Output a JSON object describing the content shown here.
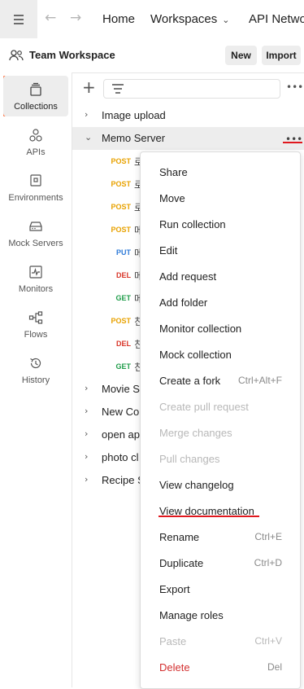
{
  "topbar": {
    "home": "Home",
    "workspaces": "Workspaces",
    "api_network": "API Network"
  },
  "workspace": {
    "title": "Team Workspace",
    "new_label": "New",
    "import_label": "Import"
  },
  "leftnav": {
    "items": [
      {
        "label": "Collections",
        "icon": "collections-icon"
      },
      {
        "label": "APIs",
        "icon": "apis-icon"
      },
      {
        "label": "Environments",
        "icon": "environments-icon"
      },
      {
        "label": "Mock Servers",
        "icon": "mock-servers-icon"
      },
      {
        "label": "Monitors",
        "icon": "monitors-icon"
      },
      {
        "label": "Flows",
        "icon": "flows-icon"
      },
      {
        "label": "History",
        "icon": "history-icon"
      }
    ]
  },
  "collections": {
    "top": [
      {
        "name": "Image upload"
      },
      {
        "name": "Memo Server"
      }
    ],
    "requests": [
      {
        "method": "POST",
        "name": "로"
      },
      {
        "method": "POST",
        "name": "로"
      },
      {
        "method": "POST",
        "name": "로"
      },
      {
        "method": "POST",
        "name": "메"
      },
      {
        "method": "PUT",
        "name": "메"
      },
      {
        "method": "DEL",
        "name": "메"
      },
      {
        "method": "GET",
        "name": "메"
      },
      {
        "method": "POST",
        "name": "친"
      },
      {
        "method": "DEL",
        "name": "친"
      },
      {
        "method": "GET",
        "name": "친"
      }
    ],
    "bottom": [
      {
        "name": "Movie S"
      },
      {
        "name": "New Co"
      },
      {
        "name": "open ap"
      },
      {
        "name": "photo cl"
      },
      {
        "name": "Recipe S"
      }
    ],
    "method_colors": {
      "POST": "#e8a200",
      "PUT": "#2f7bd8",
      "DEL": "#d9362a",
      "GET": "#1f9d4a"
    }
  },
  "context_menu": {
    "items": [
      {
        "label": "Share",
        "shortcut": "",
        "state": "normal"
      },
      {
        "label": "Move",
        "shortcut": "",
        "state": "normal"
      },
      {
        "label": "Run collection",
        "shortcut": "",
        "state": "normal"
      },
      {
        "label": "Edit",
        "shortcut": "",
        "state": "normal"
      },
      {
        "label": "Add request",
        "shortcut": "",
        "state": "normal"
      },
      {
        "label": "Add folder",
        "shortcut": "",
        "state": "normal"
      },
      {
        "label": "Monitor collection",
        "shortcut": "",
        "state": "normal"
      },
      {
        "label": "Mock collection",
        "shortcut": "",
        "state": "normal"
      },
      {
        "label": "Create a fork",
        "shortcut": "Ctrl+Alt+F",
        "state": "normal"
      },
      {
        "label": "Create pull request",
        "shortcut": "",
        "state": "disabled"
      },
      {
        "label": "Merge changes",
        "shortcut": "",
        "state": "disabled"
      },
      {
        "label": "Pull changes",
        "shortcut": "",
        "state": "disabled"
      },
      {
        "label": "View changelog",
        "shortcut": "",
        "state": "normal"
      },
      {
        "label": "View documentation",
        "shortcut": "",
        "state": "normal"
      },
      {
        "label": "Rename",
        "shortcut": "Ctrl+E",
        "state": "normal"
      },
      {
        "label": "Duplicate",
        "shortcut": "Ctrl+D",
        "state": "normal"
      },
      {
        "label": "Export",
        "shortcut": "",
        "state": "normal"
      },
      {
        "label": "Manage roles",
        "shortcut": "",
        "state": "normal"
      },
      {
        "label": "Paste",
        "shortcut": "Ctrl+V",
        "state": "disabled"
      },
      {
        "label": "Delete",
        "shortcut": "Del",
        "state": "danger"
      }
    ]
  },
  "colors": {
    "accent": "#ff6c37",
    "annotation": "#e0181e"
  }
}
